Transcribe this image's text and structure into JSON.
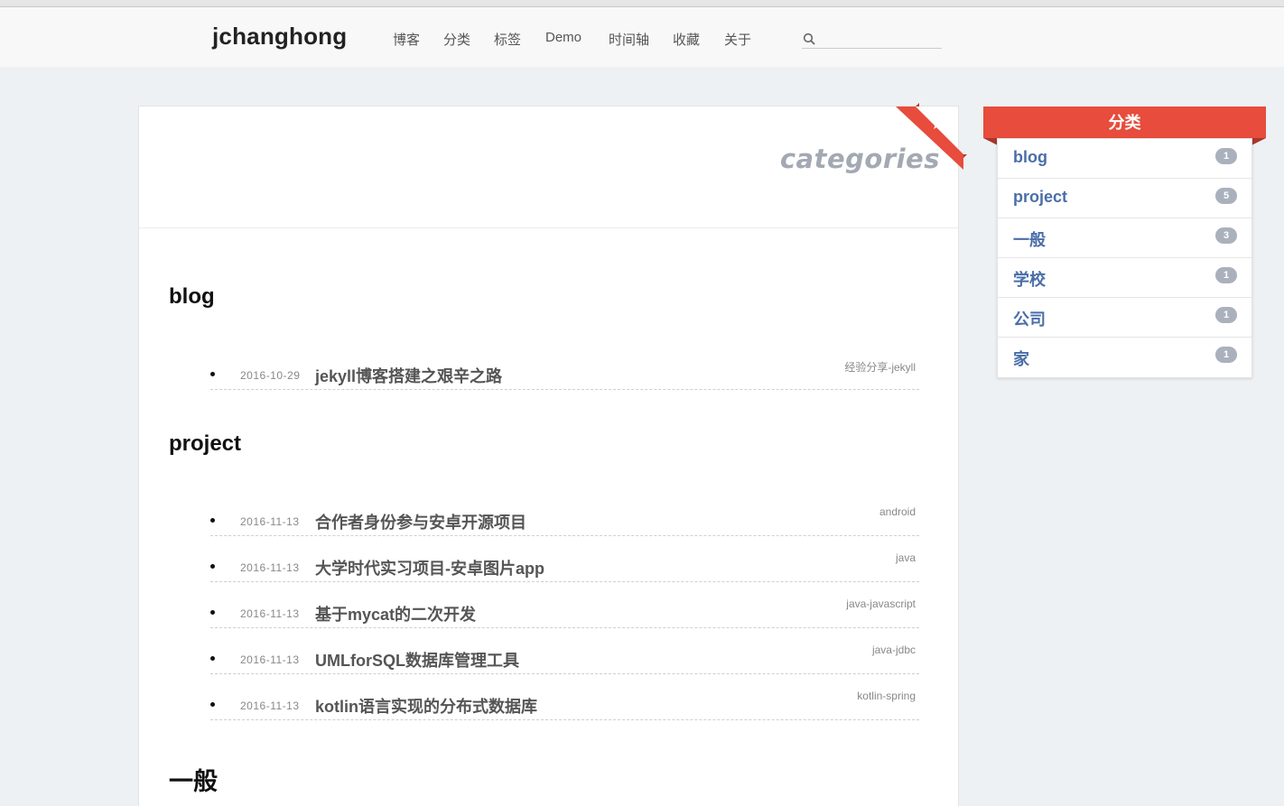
{
  "site": {
    "brand": "jchanghong"
  },
  "nav": {
    "items": [
      {
        "label": "博客"
      },
      {
        "label": "分类"
      },
      {
        "label": "标签"
      },
      {
        "label": "Demo"
      },
      {
        "label": "时间轴"
      },
      {
        "label": "收藏"
      },
      {
        "label": "关于"
      }
    ],
    "search": {
      "placeholder": "",
      "icon": "search-icon"
    }
  },
  "page": {
    "title": "categories",
    "ribbon_icon": "star-icon",
    "accent_color": "#e74c3c"
  },
  "categories": [
    {
      "name": "blog",
      "posts": [
        {
          "date": "2016-10-29",
          "title": "jekyll博客搭建之艰辛之路",
          "tags": "经验分享-jekyll"
        }
      ]
    },
    {
      "name": "project",
      "posts": [
        {
          "date": "2016-11-13",
          "title": "合作者身份参与安卓开源项目",
          "tags": "android"
        },
        {
          "date": "2016-11-13",
          "title": "大学时代实习项目-安卓图片app",
          "tags": "java"
        },
        {
          "date": "2016-11-13",
          "title": "基于mycat的二次开发",
          "tags": "java-javascript"
        },
        {
          "date": "2016-11-13",
          "title": "UMLforSQL数据库管理工具",
          "tags": "java-jdbc"
        },
        {
          "date": "2016-11-13",
          "title": "kotlin语言实现的分布式数据库",
          "tags": "kotlin-spring"
        }
      ]
    },
    {
      "name": "一般",
      "posts": []
    }
  ],
  "sidebar": {
    "title": "分类",
    "items": [
      {
        "label": "blog",
        "count": "1"
      },
      {
        "label": "project",
        "count": "5"
      },
      {
        "label": "一般",
        "count": "3"
      },
      {
        "label": "学校",
        "count": "1"
      },
      {
        "label": "公司",
        "count": "1"
      },
      {
        "label": "家",
        "count": "1"
      }
    ]
  }
}
